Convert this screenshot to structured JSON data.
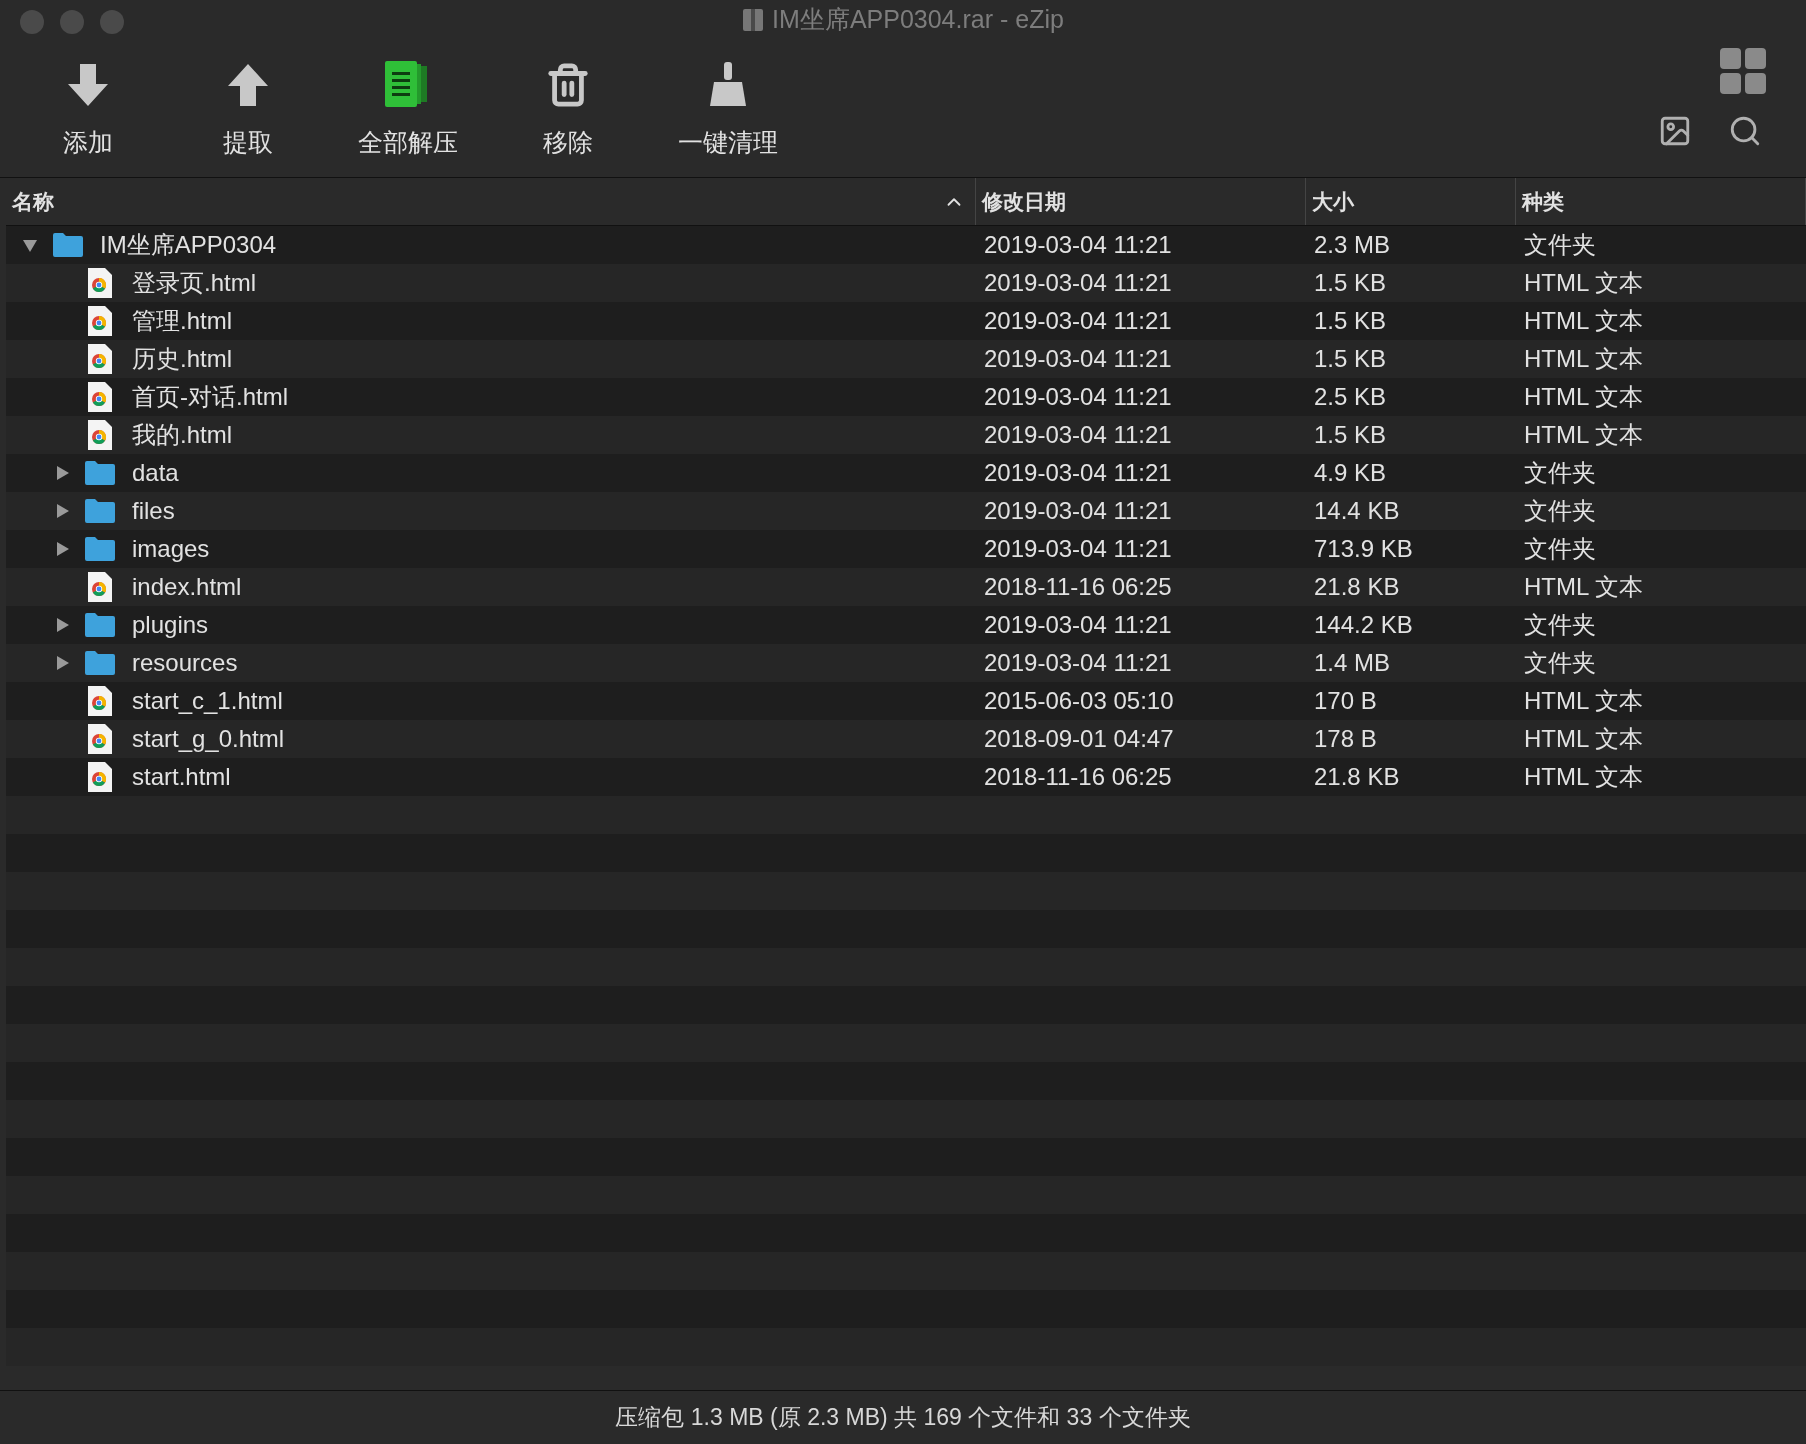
{
  "window": {
    "title": "IM坐席APP0304.rar - eZip"
  },
  "toolbar": [
    {
      "kind": "add",
      "label": "添加"
    },
    {
      "kind": "extract",
      "label": "提取"
    },
    {
      "kind": "extract-all",
      "label": "全部解压"
    },
    {
      "kind": "remove",
      "label": "移除"
    },
    {
      "kind": "clean",
      "label": "一键清理"
    }
  ],
  "columns": [
    {
      "label": "名称",
      "sorted": true
    },
    {
      "label": "修改日期",
      "sorted": false
    },
    {
      "label": "大小",
      "sorted": false
    },
    {
      "label": "种类",
      "sorted": false
    }
  ],
  "tree": [
    {
      "kind": "folder",
      "name": "IM坐席APP0304",
      "date": "2019-03-04 11:21",
      "size": "2.3 MB",
      "type": "文件夹",
      "expanded": true,
      "children": [
        {
          "kind": "file",
          "name": "登录页.html",
          "date": "2019-03-04 11:21",
          "size": "1.5 KB",
          "type": "HTML 文本"
        },
        {
          "kind": "file",
          "name": "管理.html",
          "date": "2019-03-04 11:21",
          "size": "1.5 KB",
          "type": "HTML 文本"
        },
        {
          "kind": "file",
          "name": "历史.html",
          "date": "2019-03-04 11:21",
          "size": "1.5 KB",
          "type": "HTML 文本"
        },
        {
          "kind": "file",
          "name": "首页-对话.html",
          "date": "2019-03-04 11:21",
          "size": "2.5 KB",
          "type": "HTML 文本"
        },
        {
          "kind": "file",
          "name": "我的.html",
          "date": "2019-03-04 11:21",
          "size": "1.5 KB",
          "type": "HTML 文本"
        },
        {
          "kind": "folder",
          "name": "data",
          "date": "2019-03-04 11:21",
          "size": "4.9 KB",
          "type": "文件夹",
          "expanded": false
        },
        {
          "kind": "folder",
          "name": "files",
          "date": "2019-03-04 11:21",
          "size": "14.4 KB",
          "type": "文件夹",
          "expanded": false
        },
        {
          "kind": "folder",
          "name": "images",
          "date": "2019-03-04 11:21",
          "size": "713.9 KB",
          "type": "文件夹",
          "expanded": false
        },
        {
          "kind": "file",
          "name": "index.html",
          "date": "2018-11-16 06:25",
          "size": "21.8 KB",
          "type": "HTML 文本"
        },
        {
          "kind": "folder",
          "name": "plugins",
          "date": "2019-03-04 11:21",
          "size": "144.2 KB",
          "type": "文件夹",
          "expanded": false
        },
        {
          "kind": "folder",
          "name": "resources",
          "date": "2019-03-04 11:21",
          "size": "1.4 MB",
          "type": "文件夹",
          "expanded": false
        },
        {
          "kind": "file",
          "name": "start_c_1.html",
          "date": "2015-06-03 05:10",
          "size": "170 B",
          "type": "HTML 文本"
        },
        {
          "kind": "file",
          "name": "start_g_0.html",
          "date": "2018-09-01 04:47",
          "size": "178 B",
          "type": "HTML 文本"
        },
        {
          "kind": "file",
          "name": "start.html",
          "date": "2018-11-16 06:25",
          "size": "21.8 KB",
          "type": "HTML 文本"
        }
      ]
    }
  ],
  "status_bar": "压缩包 1.3 MB (原 2.3 MB) 共 169 个文件和 33 个文件夹"
}
